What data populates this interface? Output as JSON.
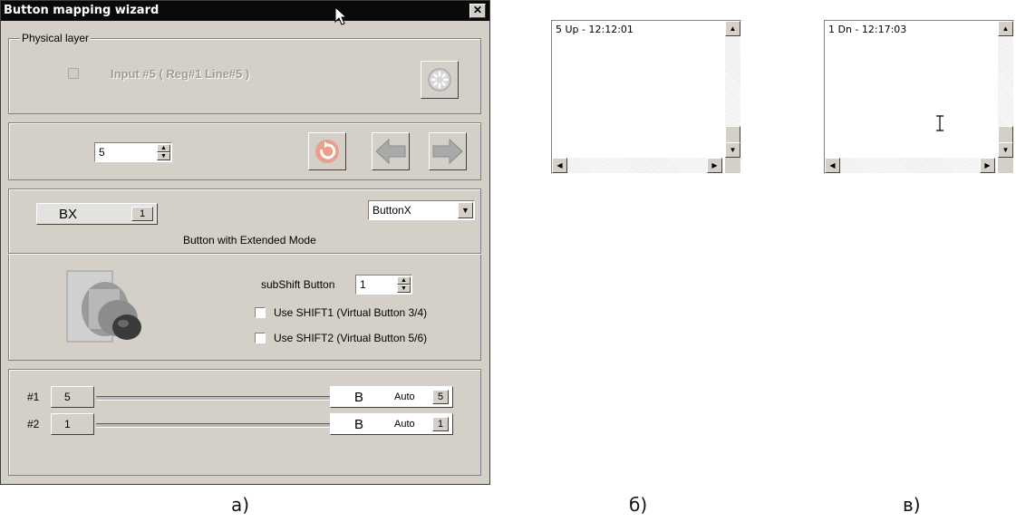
{
  "window": {
    "title": "Button mapping wizard",
    "close_glyph": "✕"
  },
  "physical_layer": {
    "group_label": "Physical layer",
    "input_text": "Input #5  ( Reg#1   Line#5 )"
  },
  "navigator": {
    "spin_value": "5"
  },
  "button_config": {
    "bx_label": "BX",
    "bx_badge": "1",
    "type_select": "ButtonX",
    "description": "Button  with Extended Mode",
    "subshift_label": "subShift Button",
    "subshift_value": "1",
    "shift1_label": "Use SHIFT1 (Virtual Button 3/4)",
    "shift2_label": "Use SHIFT2 (Virtual Button 5/6)"
  },
  "mappings": [
    {
      "index": "#1",
      "value": "5",
      "target": "B",
      "mode": "Auto",
      "mode_value": "5"
    },
    {
      "index": "#2",
      "value": "1",
      "target": "B",
      "mode": "Auto",
      "mode_value": "1"
    }
  ],
  "log_b": {
    "line": "5 Up - 12:12:01"
  },
  "log_c": {
    "line": "1 Dn - 12:17:03"
  },
  "captions": {
    "a": "а)",
    "b": "б)",
    "c": "в)"
  },
  "icons": {
    "cursor": "arrow-cursor-icon",
    "text_cursor": "i-beam-icon",
    "refresh": "refresh-icon",
    "prev": "arrow-left-icon",
    "next": "arrow-right-icon",
    "reset": "reset-loader-icon"
  }
}
